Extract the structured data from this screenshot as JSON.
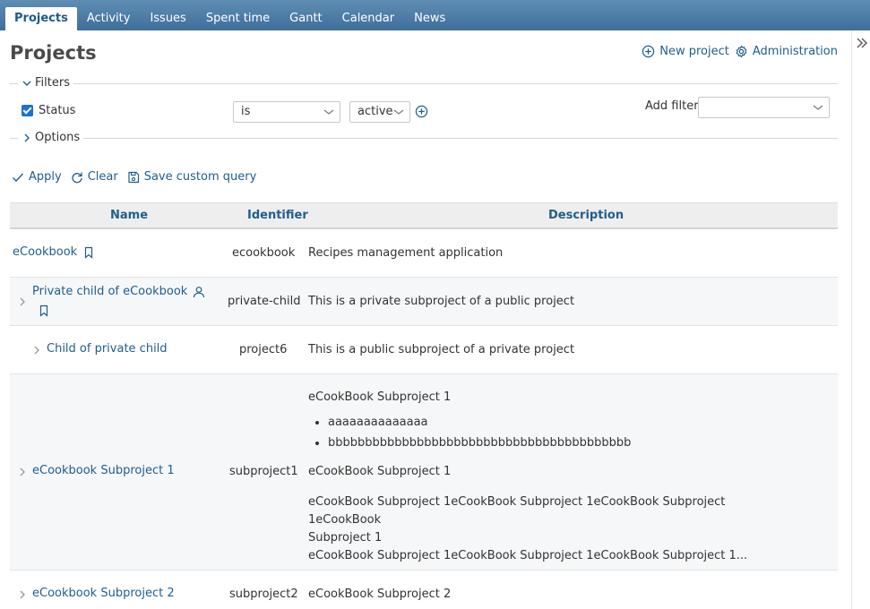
{
  "tabs": [
    {
      "label": "Projects",
      "selected": true
    },
    {
      "label": "Activity"
    },
    {
      "label": "Issues"
    },
    {
      "label": "Spent time"
    },
    {
      "label": "Gantt"
    },
    {
      "label": "Calendar"
    },
    {
      "label": "News"
    }
  ],
  "page": {
    "title": "Projects",
    "new_project_label": "New project",
    "administration_label": "Administration"
  },
  "filters": {
    "legend": "Filters",
    "status_label": "Status",
    "status_checked": true,
    "operator": "is",
    "value": "active",
    "add_filter_label": "Add filter",
    "add_filter_value": ""
  },
  "options": {
    "legend": "Options"
  },
  "actions": {
    "apply": "Apply",
    "clear": "Clear",
    "save": "Save custom query"
  },
  "table": {
    "headers": {
      "name": "Name",
      "identifier": "Identifier",
      "description": "Description"
    },
    "rows": [
      {
        "name": "eCookbook",
        "identifier": "ecookbook",
        "description": "Recipes management application"
      },
      {
        "name": "Private child of eCookbook",
        "identifier": "private-child",
        "description": "This is a private subproject of a public project"
      },
      {
        "name": "Child of private child",
        "identifier": "project6",
        "description": "This is a public subproject of a private project"
      },
      {
        "name": "eCookbook Subproject 1",
        "identifier": "subproject1",
        "description_lines": {
          "p1": "eCookBook Subproject 1",
          "bullet1": "aaaaaaaaaaaaaa",
          "bullet2": "bbbbbbbbbbbbbbbbbbbbbbbbbbbbbbbbbbbbbbbbb",
          "p2": "eCookBook Subproject 1",
          "p3a": "eCookBook Subproject 1eCookBook Subproject 1eCookBook Subproject 1eCookBook",
          "p3b": "Subproject 1",
          "p4": "eCookBook Subproject 1eCookBook Subproject 1eCookBook Subproject 1..."
        }
      },
      {
        "name": "eCookbook Subproject 2",
        "identifier": "subproject2",
        "description": "eCookBook Subproject 2"
      }
    ]
  }
}
